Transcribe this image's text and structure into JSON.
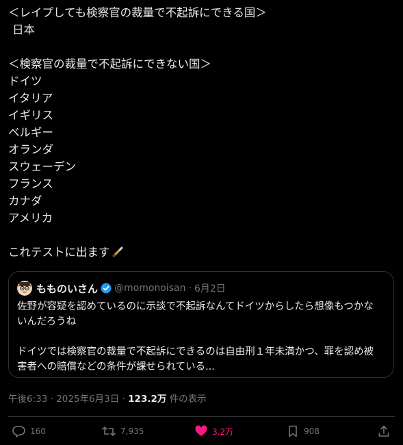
{
  "post": {
    "lines": [
      "＜レイプしても検察官の裁量で不起訴にできる国＞",
      "日本",
      "",
      "＜検察官の裁量で不起訴にできない国＞",
      "ドイツ",
      "イタリア",
      "イギリス",
      "ベルギー",
      "オランダ",
      "スウェーデン",
      "フランス",
      "カナダ",
      "アメリカ",
      "",
      "これテストに出ます"
    ],
    "emoji": "pen-icon"
  },
  "quote": {
    "name": "もものいさん",
    "handle": "@momonoisan",
    "dot": "·",
    "date": "6月2日",
    "body_lines": [
      "佐野が容疑を認めているのに示談で不起訴なんてドイツからしたら想像もつかな",
      "いんだろうね",
      "",
      "ドイツでは検察官の裁量で不起訴にできるのは自由刑１年未満かつ、罪を認め被",
      "害者への賠償などの条件が課せられている..."
    ]
  },
  "meta": {
    "time": "午後6:33",
    "sep": "·",
    "date": "2025年6月3日",
    "sep2": "·",
    "views": "123.2万",
    "views_label": "件の表示"
  },
  "actions": {
    "reply": "160",
    "retweet": "7,935",
    "like": "3.2万",
    "bookmark": "908"
  },
  "colors": {
    "background": "#000000",
    "text": "#e7e9ea",
    "muted": "#71767b",
    "like": "#f91880",
    "verified": "#1d9bf0"
  }
}
